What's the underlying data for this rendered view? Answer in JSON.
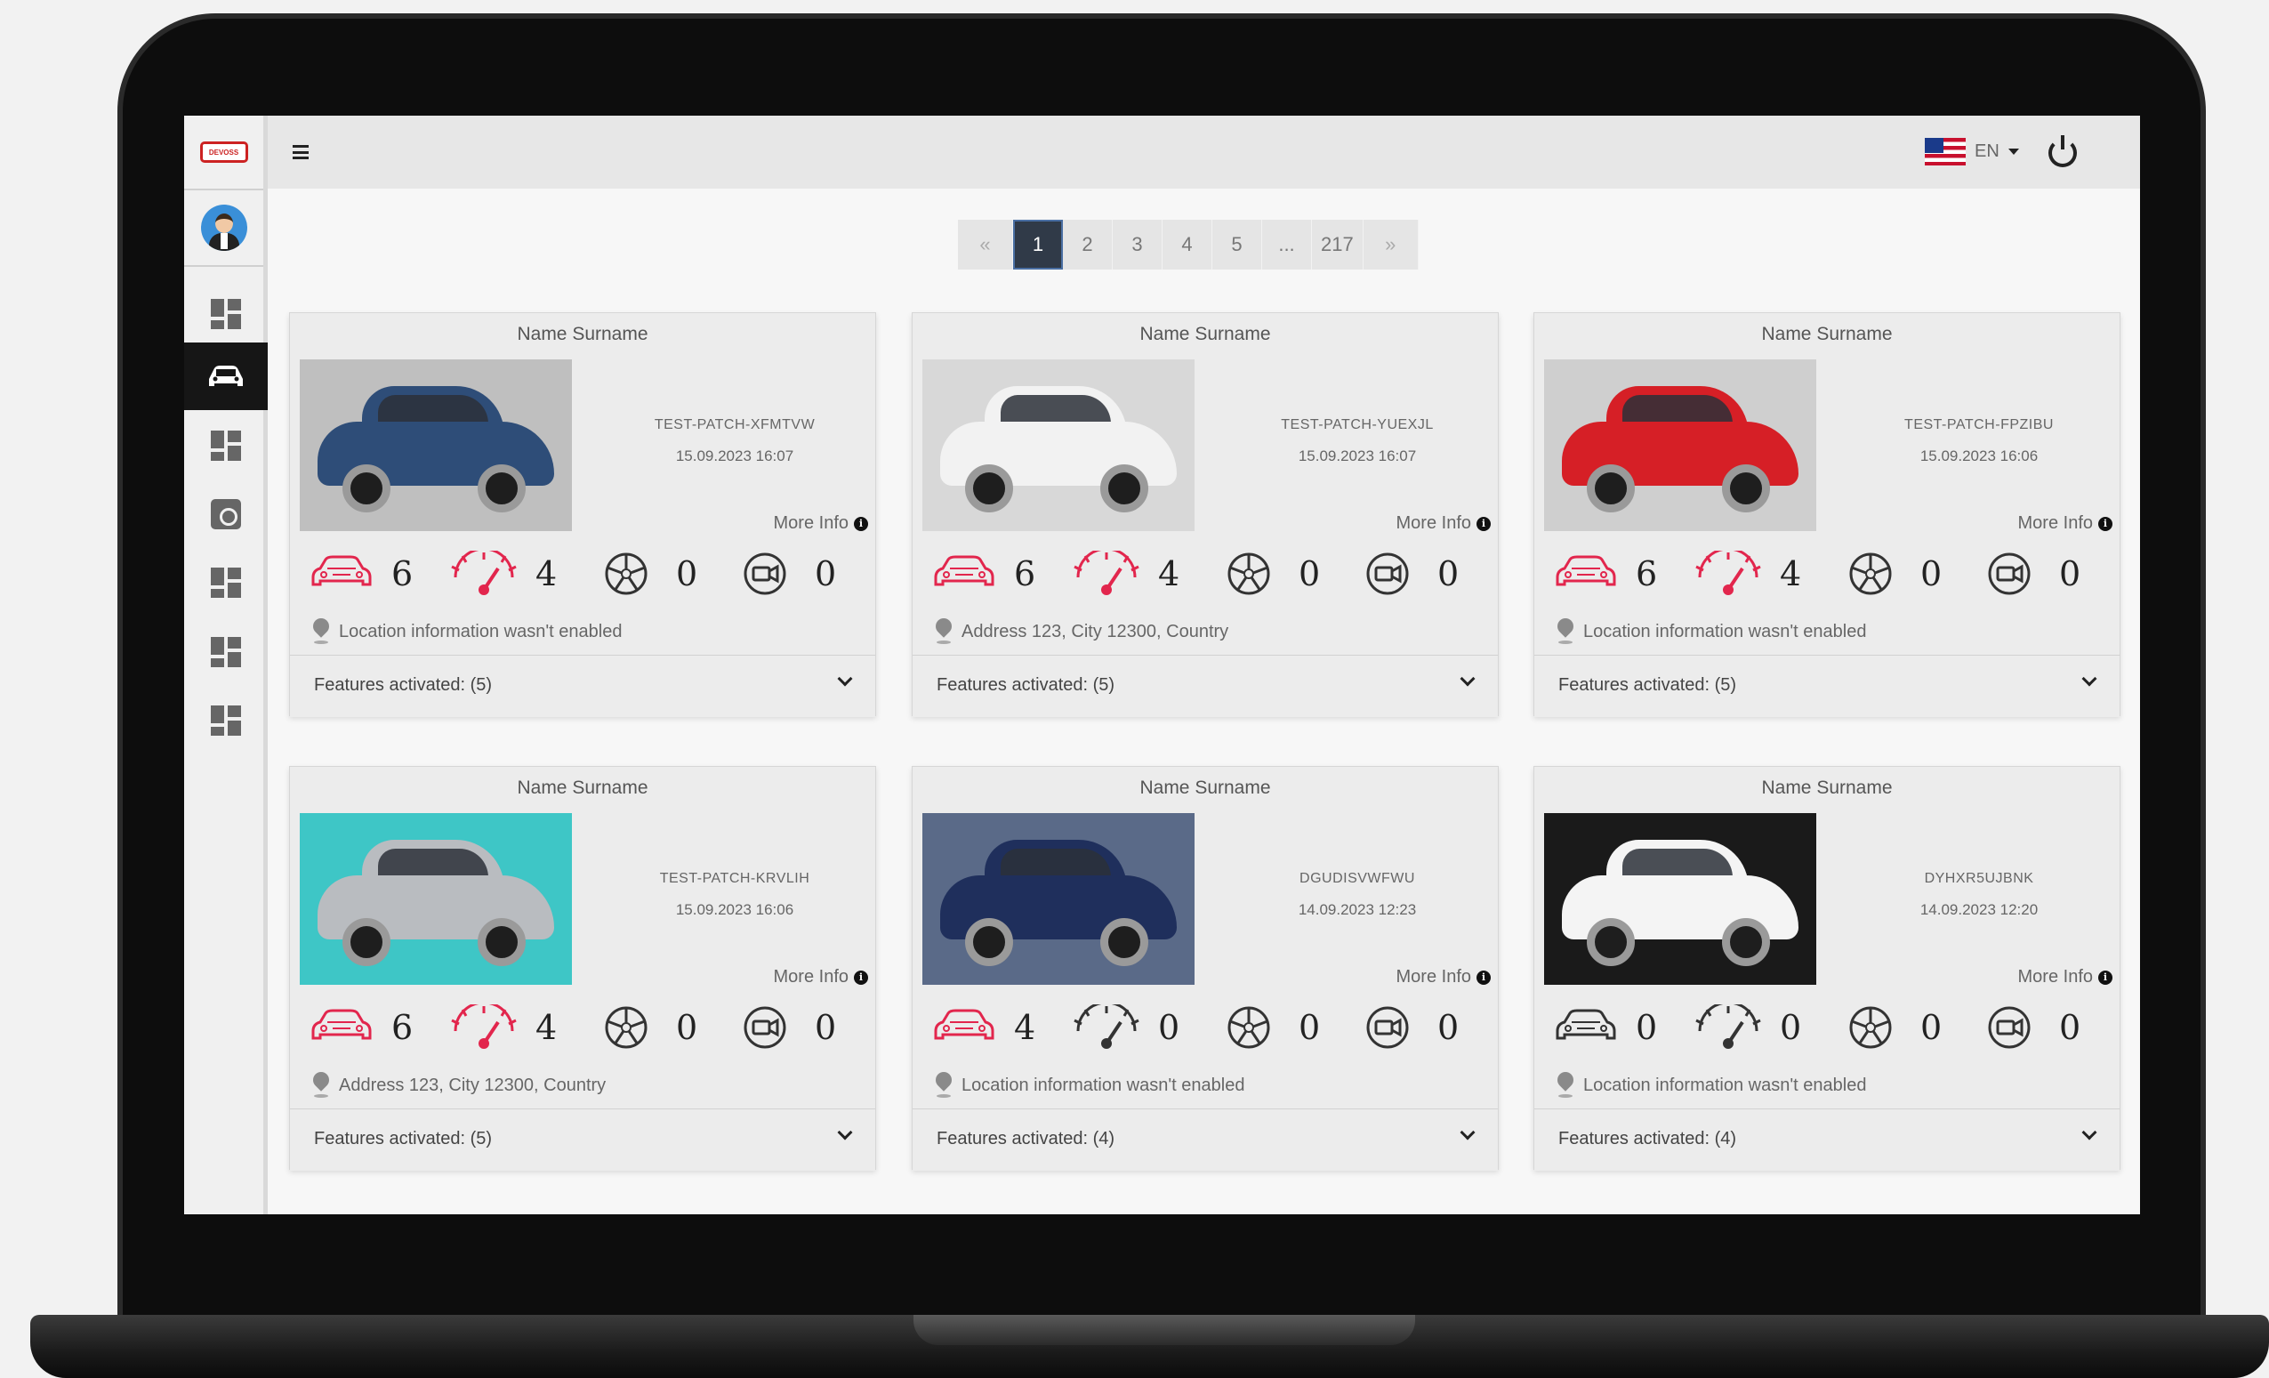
{
  "topbar": {
    "language": "EN"
  },
  "sidebar": {
    "logo_text": "DEVOSS",
    "items": [
      {
        "icon": "dashboard-icon",
        "active": false
      },
      {
        "icon": "car-icon",
        "active": true
      },
      {
        "icon": "dashboard-icon",
        "active": false
      },
      {
        "icon": "gear-icon",
        "active": false
      },
      {
        "icon": "dashboard-icon",
        "active": false
      },
      {
        "icon": "dashboard-icon",
        "active": false
      },
      {
        "icon": "dashboard-icon",
        "active": false
      }
    ]
  },
  "pagination": {
    "prev": "«",
    "pages": [
      "1",
      "2",
      "3",
      "4",
      "5",
      "...",
      "217"
    ],
    "current": "1",
    "next": "»"
  },
  "common": {
    "more_info": "More Info",
    "info_glyph": "i"
  },
  "colors": {
    "accent": "#e2264d",
    "neutral_icon": "#333333",
    "active_nav": "#161616"
  },
  "cards": [
    {
      "name": "Name Surname",
      "id": "TEST-PATCH-XFMTVW",
      "date": "15.09.2023 16:07",
      "stats": {
        "damage": "6",
        "gauge": "4",
        "wheel": "0",
        "camera": "0"
      },
      "location": "Location information wasn't enabled",
      "features": "Features activated: (5)",
      "car_color": "#2e4d78",
      "bg": "#bfbfbf"
    },
    {
      "name": "Name Surname",
      "id": "TEST-PATCH-YUEXJL",
      "date": "15.09.2023 16:07",
      "stats": {
        "damage": "6",
        "gauge": "4",
        "wheel": "0",
        "camera": "0"
      },
      "location": "Address 123, City 12300, Country",
      "features": "Features activated: (5)",
      "car_color": "#f2f2f2",
      "bg": "#d8d8d8"
    },
    {
      "name": "Name Surname",
      "id": "TEST-PATCH-FPZIBU",
      "date": "15.09.2023 16:06",
      "stats": {
        "damage": "6",
        "gauge": "4",
        "wheel": "0",
        "camera": "0"
      },
      "location": "Location information wasn't enabled",
      "features": "Features activated: (5)",
      "car_color": "#d61f26",
      "bg": "#cfcfcf"
    },
    {
      "name": "Name Surname",
      "id": "TEST-PATCH-KRVLIH",
      "date": "15.09.2023 16:06",
      "stats": {
        "damage": "6",
        "gauge": "4",
        "wheel": "0",
        "camera": "0"
      },
      "location": "Address 123, City 12300, Country",
      "features": "Features activated: (5)",
      "car_color": "#b9bcc0",
      "bg": "#3ec6c6"
    },
    {
      "name": "Name Surname",
      "id": "DGUDISVWFWU",
      "date": "14.09.2023 12:23",
      "stats": {
        "damage": "4",
        "gauge": "0",
        "wheel": "0",
        "camera": "0"
      },
      "location": "Location information wasn't enabled",
      "features": "Features activated: (4)",
      "car_color": "#1f2f5c",
      "bg": "#5a6a88"
    },
    {
      "name": "Name Surname",
      "id": "DYHXR5UJBNK",
      "date": "14.09.2023 12:20",
      "stats": {
        "damage": "0",
        "gauge": "0",
        "wheel": "0",
        "camera": "0"
      },
      "location": "Location information wasn't enabled",
      "features": "Features activated: (4)",
      "car_color": "#f4f4f4",
      "bg": "#1a1a1a"
    }
  ]
}
